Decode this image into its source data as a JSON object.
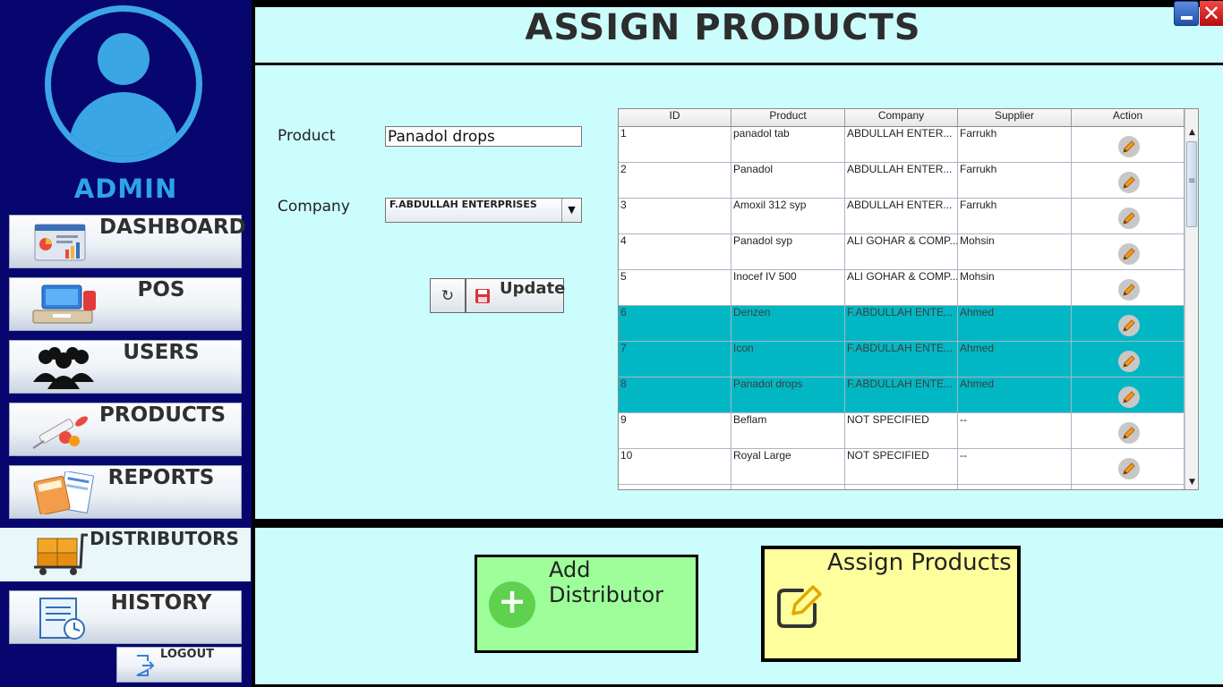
{
  "sidebar": {
    "user_label": "ADMIN",
    "items": [
      {
        "label": "DASHBOARD",
        "icon": "dashboard-icon"
      },
      {
        "label": "POS",
        "icon": "pos-terminal-icon"
      },
      {
        "label": "USERS",
        "icon": "users-group-icon"
      },
      {
        "label": "PRODUCTS",
        "icon": "medicine-syringe-icon"
      },
      {
        "label": "REPORTS",
        "icon": "reports-calculator-icon"
      },
      {
        "label": "DISTRIBUTORS",
        "icon": "distribution-cart-icon",
        "active": true
      },
      {
        "label": "HISTORY",
        "icon": "history-receipt-icon"
      }
    ],
    "logout_label": "LOGOUT"
  },
  "header": {
    "title": "ASSIGN PRODUCTS"
  },
  "form": {
    "product_label": "Product",
    "product_value": "Panadol drops",
    "company_label": "Company",
    "company_value": "F.ABDULLAH ENTERPRISES",
    "refresh_icon": "refresh-icon",
    "update_label": "Update"
  },
  "table": {
    "columns": [
      "ID",
      "Product",
      "Company",
      "Supplier",
      "Action"
    ],
    "rows": [
      {
        "id": "1",
        "product": "panadol tab",
        "company": "ABDULLAH ENTER...",
        "supplier": "Farrukh",
        "selected": false
      },
      {
        "id": "2",
        "product": "Panadol",
        "company": "ABDULLAH ENTER...",
        "supplier": "Farrukh",
        "selected": false
      },
      {
        "id": "3",
        "product": "Amoxil 312 syp",
        "company": "ABDULLAH ENTER...",
        "supplier": "Farrukh",
        "selected": false
      },
      {
        "id": "4",
        "product": "Panadol syp",
        "company": "ALI GOHAR & COMP...",
        "supplier": "Mohsin",
        "selected": false
      },
      {
        "id": "5",
        "product": "Inocef IV 500",
        "company": "ALI GOHAR & COMP...",
        "supplier": "Mohsin",
        "selected": false
      },
      {
        "id": "6",
        "product": "Denzen",
        "company": "F.ABDULLAH ENTE...",
        "supplier": "Ahmed",
        "selected": true
      },
      {
        "id": "7",
        "product": "Icon",
        "company": "F.ABDULLAH ENTE...",
        "supplier": "Ahmed",
        "selected": true
      },
      {
        "id": "8",
        "product": "Panadol drops",
        "company": "F.ABDULLAH ENTE...",
        "supplier": "Ahmed",
        "selected": true
      },
      {
        "id": "9",
        "product": "Beflam",
        "company": "NOT SPECIFIED",
        "supplier": "--",
        "selected": false
      },
      {
        "id": "10",
        "product": "Royal Large",
        "company": "NOT SPECIFIED",
        "supplier": "--",
        "selected": false
      },
      {
        "id": "",
        "product": "",
        "company": "",
        "supplier": "",
        "selected": false
      }
    ]
  },
  "actions": {
    "add_distributor_label": "Add Distributor",
    "assign_products_label": "Assign Products"
  },
  "colors": {
    "sidebar_bg": "#06066e",
    "panel_bg": "#ccfdfd",
    "accent_blue": "#2ea3e8",
    "selected_row": "#00b7c3",
    "add_button": "#9efe9a",
    "assign_button": "#fffe9c"
  }
}
